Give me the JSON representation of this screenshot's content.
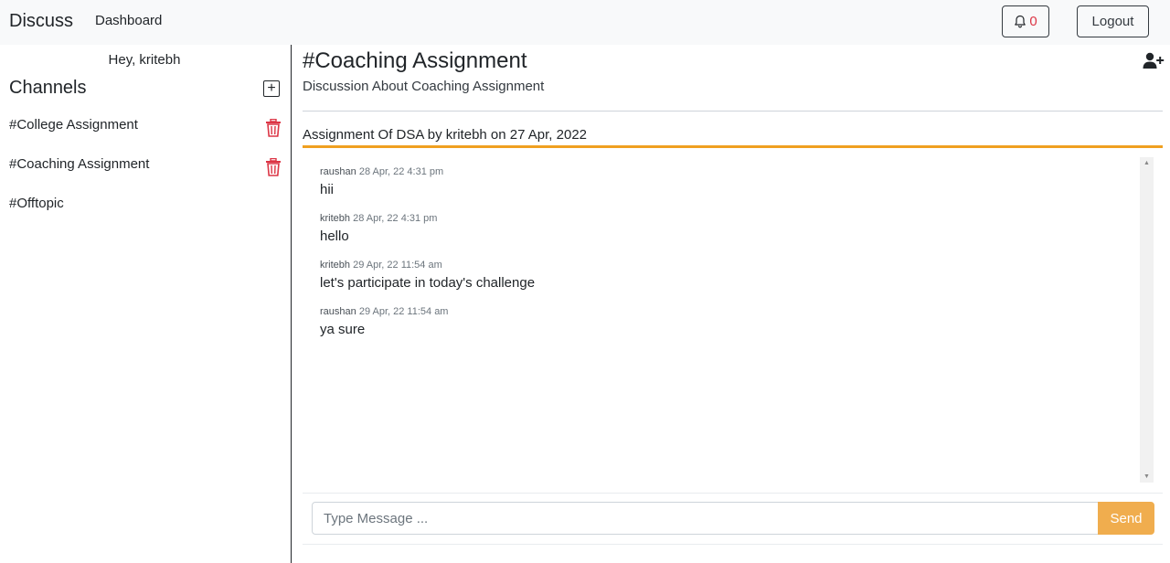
{
  "navbar": {
    "brand": "Discuss",
    "dashboard_link": "Dashboard",
    "notification_count": "0",
    "logout_label": "Logout"
  },
  "sidebar": {
    "greeting": "Hey, kritebh",
    "channels_title": "Channels",
    "add_channel_icon": "plus-square-icon",
    "channels": [
      {
        "label": "#College Assignment",
        "deletable": true
      },
      {
        "label": "#Coaching Assignment",
        "deletable": true
      },
      {
        "label": "#Offtopic",
        "deletable": false
      }
    ]
  },
  "main": {
    "channel_title": "#Coaching Assignment",
    "channel_description": "Discussion About Coaching Assignment",
    "topic": "Assignment Of DSA by kritebh on 27 Apr, 2022",
    "messages": [
      {
        "author": "raushan",
        "time": "28 Apr, 22 4:31 pm",
        "text": "hii"
      },
      {
        "author": "kritebh",
        "time": "28 Apr, 22 4:31 pm",
        "text": "hello"
      },
      {
        "author": "kritebh",
        "time": "29 Apr, 22 11:54 am",
        "text": "let's participate in today's challenge"
      },
      {
        "author": "raushan",
        "time": "29 Apr, 22 11:54 am",
        "text": "ya sure"
      }
    ],
    "input_placeholder": "Type Message ...",
    "send_label": "Send"
  },
  "colors": {
    "accent": "#f0ad4e",
    "topic_underline": "#f0a020",
    "delete": "#dc3545",
    "navbar_bg": "#f8f9fa"
  },
  "icons": [
    "bell-icon",
    "plus-square-icon",
    "trash-icon",
    "user-plus-icon"
  ]
}
